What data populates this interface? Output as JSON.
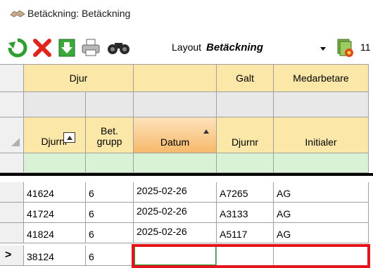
{
  "window": {
    "title": "Betäckning: Betäckning",
    "title_icon": "handshake-icon"
  },
  "toolbar": {
    "layout_label": "Layout",
    "layout_value": "Betäckning",
    "counter": "11",
    "icons": [
      "refresh-icon",
      "delete-icon",
      "download-icon",
      "print-icon",
      "binoculars-icon",
      "layout-settings-icon"
    ]
  },
  "grid": {
    "group_headers": {
      "djur": "Djur",
      "galt": "Galt",
      "medarbetare": "Medarbetare"
    },
    "columns": {
      "djurnr": "Djurnr",
      "bet_grupp": "Bet.\ngrupp",
      "datum": "Datum",
      "galt_djurnr": "Djurnr",
      "initialer": "Initialer"
    },
    "sort_indicator": "ascending",
    "rows": [
      {
        "djurnr": "41624",
        "bet_grupp": "6",
        "datum": "2025-02-26",
        "galt_djurnr": "A7265",
        "initialer": "AG"
      },
      {
        "djurnr": "41724",
        "bet_grupp": "6",
        "datum": "2025-02-26",
        "galt_djurnr": "A3133",
        "initialer": "AG"
      },
      {
        "djurnr": "41824",
        "bet_grupp": "6",
        "datum": "2025-02-26",
        "galt_djurnr": "A5117",
        "initialer": "AG"
      },
      {
        "djurnr": "38124",
        "bet_grupp": "6",
        "datum": "",
        "galt_djurnr": "",
        "initialer": ""
      }
    ],
    "current_row_marker": ">",
    "colors": {
      "header": "#fbe8a8",
      "sorted_header": "#f6b96a",
      "filter_row": "#d9f2d6",
      "highlight": "#e3141b"
    }
  }
}
